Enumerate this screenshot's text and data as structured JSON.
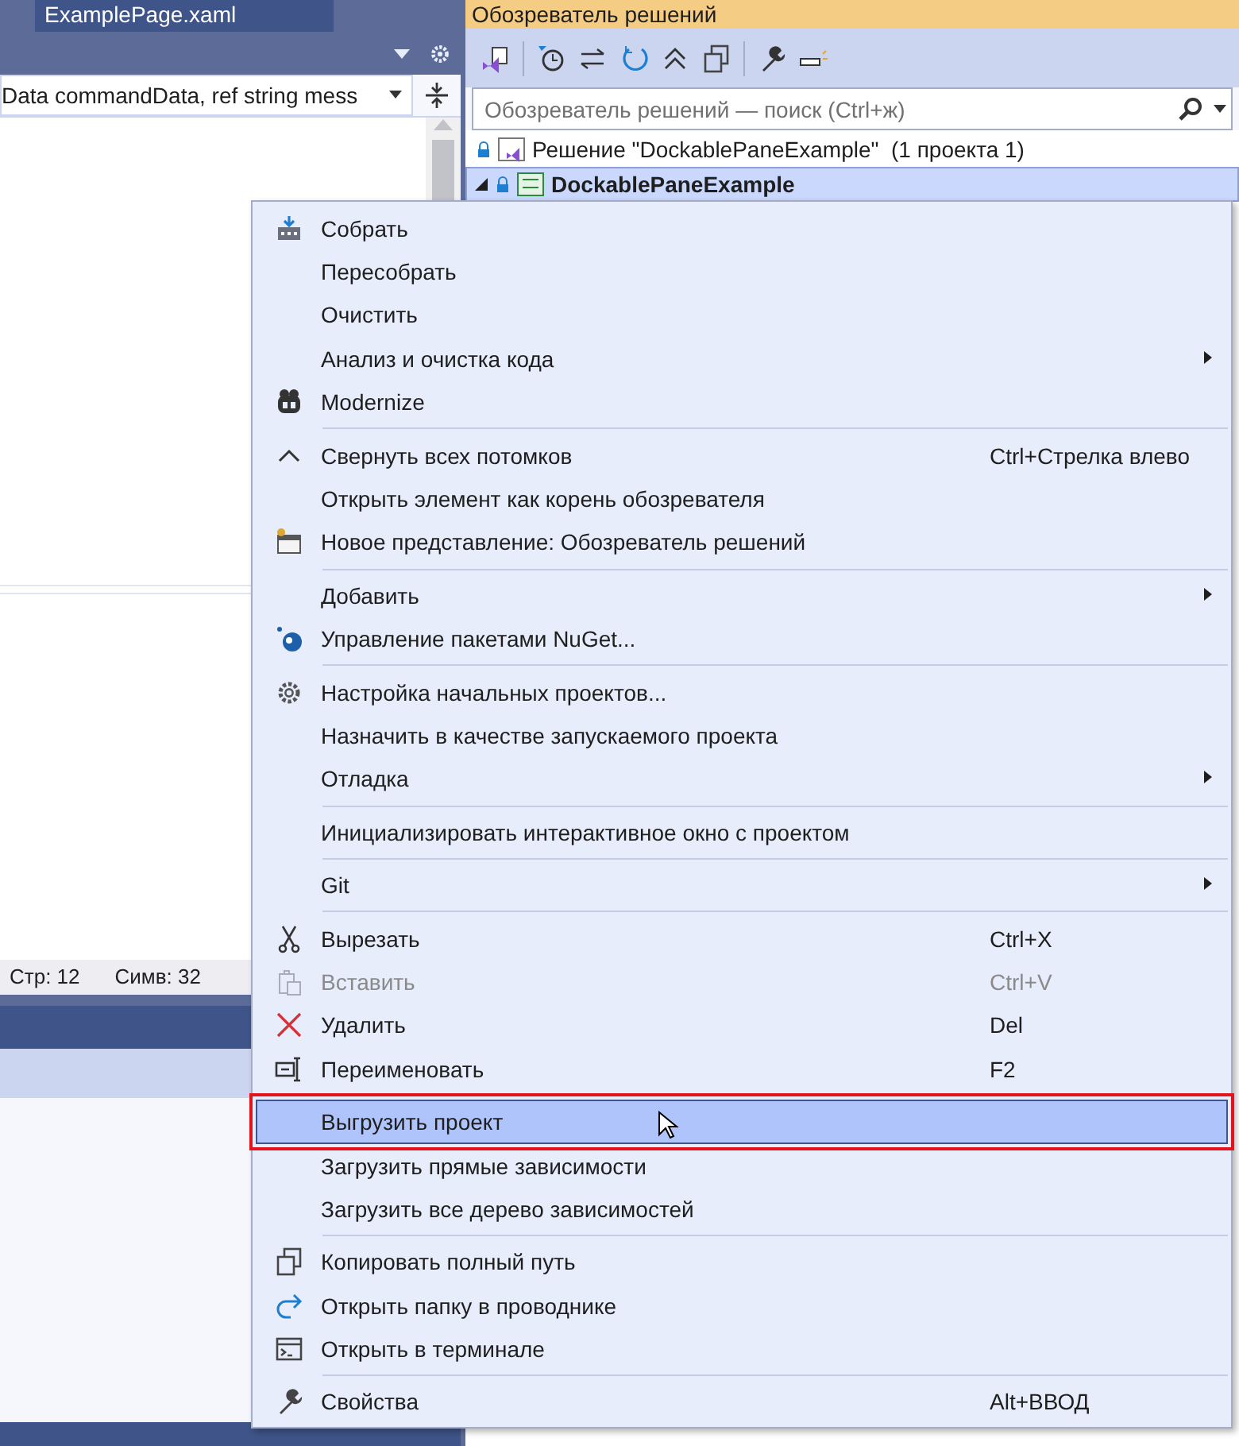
{
  "editor": {
    "tab": "ExamplePage.xaml",
    "member_dropdown": "Data commandData, ref string mess",
    "status": [
      "Стр: 12",
      "Симв: 32"
    ]
  },
  "solution_explorer": {
    "title": "Обозреватель решений",
    "search": {
      "placeholder": "Обозреватель решений — поиск (Ctrl+ж)"
    },
    "tree": [
      {
        "label": "Решение \"DockablePaneExample\"  (1 проекта 1)",
        "selected": false,
        "children": [
          {
            "label": "DockablePaneExample",
            "selected": true,
            "expanded": true
          }
        ]
      }
    ]
  },
  "context_menu": [
    {
      "kind": "item",
      "label": "Собрать",
      "submenu": false,
      "disabled": false,
      "selected": false
    },
    {
      "kind": "item",
      "label": "Пересобрать",
      "submenu": false,
      "disabled": false,
      "selected": false
    },
    {
      "kind": "item",
      "label": "Очистить",
      "submenu": false,
      "disabled": false,
      "selected": false
    },
    {
      "kind": "item",
      "label": "Анализ и очистка кода",
      "submenu": true,
      "disabled": false,
      "selected": false
    },
    {
      "kind": "item",
      "label": "Modernize",
      "submenu": false,
      "disabled": false,
      "selected": false
    },
    {
      "kind": "separator"
    },
    {
      "kind": "item",
      "label": "Свернуть всех потомков",
      "shortcut": "Ctrl+Стрелка влево",
      "submenu": false,
      "disabled": false,
      "selected": false
    },
    {
      "kind": "item",
      "label": "Открыть элемент как корень обозревателя",
      "submenu": false,
      "disabled": false,
      "selected": false
    },
    {
      "kind": "item",
      "label": "Новое представление: Обозреватель решений",
      "submenu": false,
      "disabled": false,
      "selected": false
    },
    {
      "kind": "separator"
    },
    {
      "kind": "item",
      "label": "Добавить",
      "submenu": true,
      "disabled": false,
      "selected": false
    },
    {
      "kind": "item",
      "label": "Управление пакетами NuGet...",
      "submenu": false,
      "disabled": false,
      "selected": false
    },
    {
      "kind": "separator"
    },
    {
      "kind": "item",
      "label": "Настройка начальных проектов...",
      "submenu": false,
      "disabled": false,
      "selected": false
    },
    {
      "kind": "item",
      "label": "Назначить в качестве запускаемого проекта",
      "submenu": false,
      "disabled": false,
      "selected": false
    },
    {
      "kind": "item",
      "label": "Отладка",
      "submenu": true,
      "disabled": false,
      "selected": false
    },
    {
      "kind": "separator"
    },
    {
      "kind": "item",
      "label": "Инициализировать интерактивное окно с проектом",
      "submenu": false,
      "disabled": false,
      "selected": false
    },
    {
      "kind": "separator"
    },
    {
      "kind": "item",
      "label": "Git",
      "submenu": true,
      "disabled": false,
      "selected": false
    },
    {
      "kind": "separator"
    },
    {
      "kind": "item",
      "label": "Вырезать",
      "shortcut": "Ctrl+X",
      "submenu": false,
      "disabled": false,
      "selected": false
    },
    {
      "kind": "item",
      "label": "Вставить",
      "shortcut": "Ctrl+V",
      "submenu": false,
      "disabled": true,
      "selected": false
    },
    {
      "kind": "item",
      "label": "Удалить",
      "shortcut": "Del",
      "submenu": false,
      "disabled": false,
      "selected": false
    },
    {
      "kind": "item",
      "label": "Переименовать",
      "shortcut": "F2",
      "submenu": false,
      "disabled": false,
      "selected": false
    },
    {
      "kind": "separator"
    },
    {
      "kind": "item",
      "label": "Выгрузить проект",
      "submenu": false,
      "disabled": false,
      "selected": true
    },
    {
      "kind": "item",
      "label": "Загрузить прямые зависимости",
      "submenu": false,
      "disabled": false,
      "selected": false
    },
    {
      "kind": "item",
      "label": "Загрузить все дерево зависимостей",
      "submenu": false,
      "disabled": false,
      "selected": false
    },
    {
      "kind": "separator"
    },
    {
      "kind": "item",
      "label": "Копировать полный путь",
      "submenu": false,
      "disabled": false,
      "selected": false
    },
    {
      "kind": "item",
      "label": "Открыть папку в проводнике",
      "submenu": false,
      "disabled": false,
      "selected": false
    },
    {
      "kind": "item",
      "label": "Открыть в терминале",
      "submenu": false,
      "disabled": false,
      "selected": false
    },
    {
      "kind": "separator"
    },
    {
      "kind": "item",
      "label": "Свойства",
      "shortcut": "Alt+ВВОД",
      "submenu": false,
      "disabled": false,
      "selected": false
    }
  ]
}
